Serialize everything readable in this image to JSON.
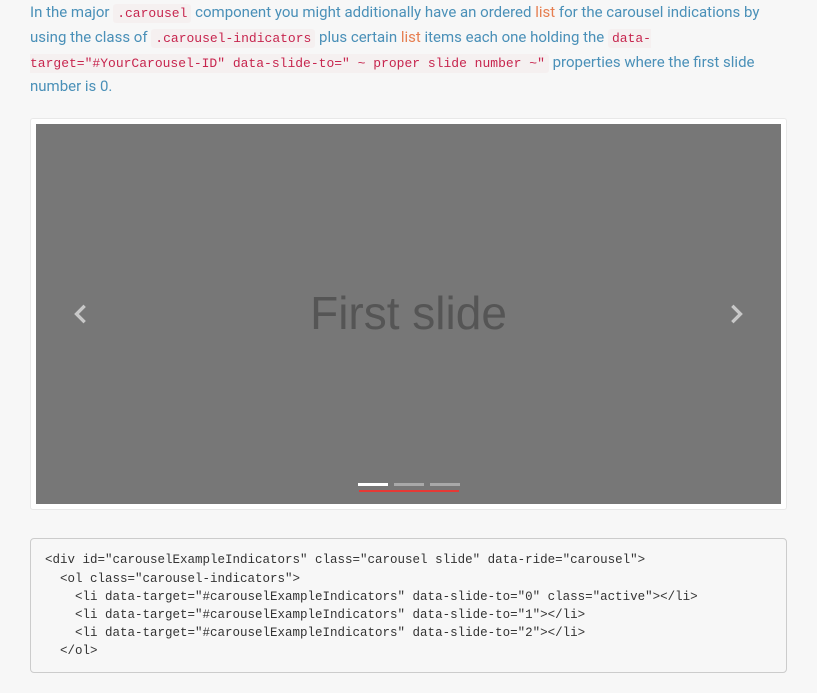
{
  "intro": {
    "part1": "In the major ",
    "code1": ".carousel",
    "part2": " component you might additionally have an ordered ",
    "list_word1": "list",
    "part3": " for the carousel indications by using the class of ",
    "code2": ".carousel-indicators",
    "part4": " plus certain ",
    "list_word2": "list",
    "part5": " items each one holding the ",
    "code3": "data-target=\"#YourCarousel-ID\" data-slide-to=\" ~ proper slide number ~\"",
    "part6": " properties where the first slide number is 0."
  },
  "carousel": {
    "slide_text": "First slide",
    "prev_label": "Previous",
    "next_label": "Next",
    "indicators": [
      {
        "active": true
      },
      {
        "active": false
      },
      {
        "active": false
      }
    ]
  },
  "code": {
    "content": "<div id=\"carouselExampleIndicators\" class=\"carousel slide\" data-ride=\"carousel\">\n  <ol class=\"carousel-indicators\">\n    <li data-target=\"#carouselExampleIndicators\" data-slide-to=\"0\" class=\"active\"></li>\n    <li data-target=\"#carouselExampleIndicators\" data-slide-to=\"1\"></li>\n    <li data-target=\"#carouselExampleIndicators\" data-slide-to=\"2\"></li>\n  </ol>"
  }
}
